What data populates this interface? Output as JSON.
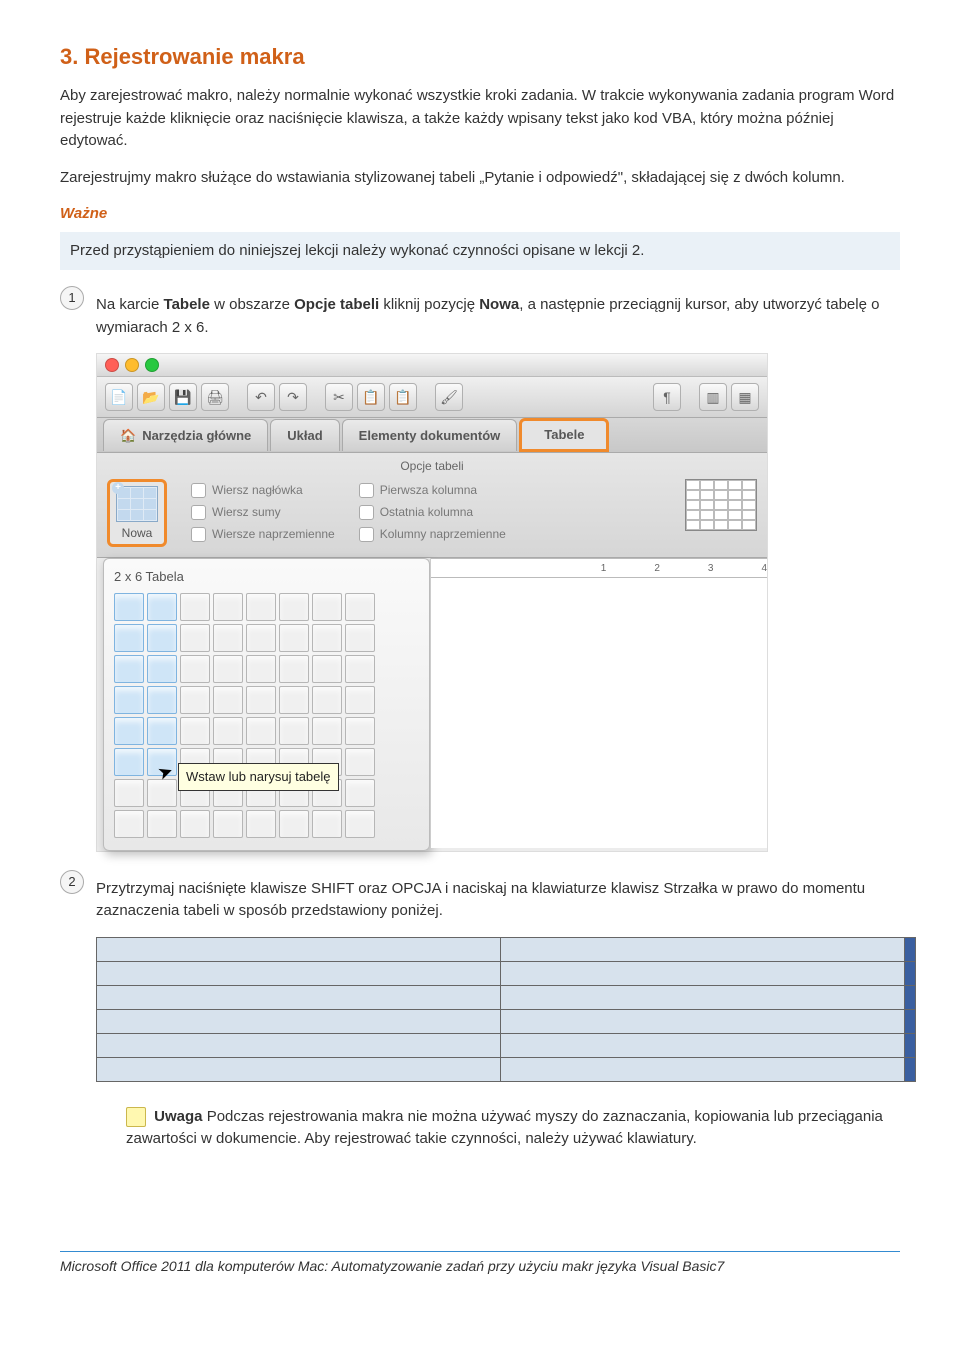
{
  "heading": "3. Rejestrowanie makra",
  "intro1": "Aby zarejestrować makro, należy normalnie wykonać wszystkie kroki zadania. W trakcie wykonywania zadania program Word rejestruje każde kliknięcie oraz naciśnięcie klawisza, a także każdy wpisany tekst jako kod VBA, który można później edytować.",
  "intro2": "Zarejestrujmy makro służące do wstawiania stylizowanej tabeli „Pytanie i odpowiedź\", składającej się z dwóch kolumn.",
  "important_label": "Ważne",
  "important_text": "Przed przystąpieniem do niniejszej lekcji należy wykonać czynności opisane w lekcji 2.",
  "step1_num": "1",
  "step1_pre": "Na karcie ",
  "step1_b1": "Tabele",
  "step1_mid1": " w obszarze ",
  "step1_b2": "Opcje tabeli",
  "step1_mid2": " kliknij pozycję ",
  "step1_b3": "Nowa",
  "step1_post": ", a następnie przeciągnij kursor, aby utworzyć tabelę o wymiarach 2 x 6.",
  "step2_num": "2",
  "step2_text": "Przytrzymaj naciśnięte klawisze SHIFT oraz OPCJA i naciskaj na klawiaturze klawisz Strzałka w prawo do momentu zaznaczenia tabeli w sposób przedstawiony poniżej.",
  "note_b": "Uwaga",
  "note_text": " Podczas rejestrowania makra nie można używać myszy do zaznaczania, kopiowania lub przeciągania zawartości w dokumencie. Aby rejestrować takie czynności, należy używać klawiatury.",
  "footer": "Microsoft Office 2011 dla komputerów Mac: Automatyzowanie zadań przy użyciu makr języka Visual Basic7",
  "ui": {
    "tab_home": "Narzędzia główne",
    "tab_layout": "Układ",
    "tab_elements": "Elementy dokumentów",
    "tab_tables": "Tabele",
    "group_label": "Opcje tabeli",
    "nowa": "Nowa",
    "chk1": "Wiersz nagłówka",
    "chk2": "Wiersz sumy",
    "chk3": "Wiersze naprzemienne",
    "chk4": "Pierwsza kolumna",
    "chk5": "Ostatnia kolumna",
    "chk6": "Kolumny naprzemienne",
    "grid_title": "2 x 6 Tabela",
    "tooltip": "Wstaw lub narysuj tabelę",
    "ruler": [
      "1",
      "2",
      "3",
      "4"
    ]
  }
}
